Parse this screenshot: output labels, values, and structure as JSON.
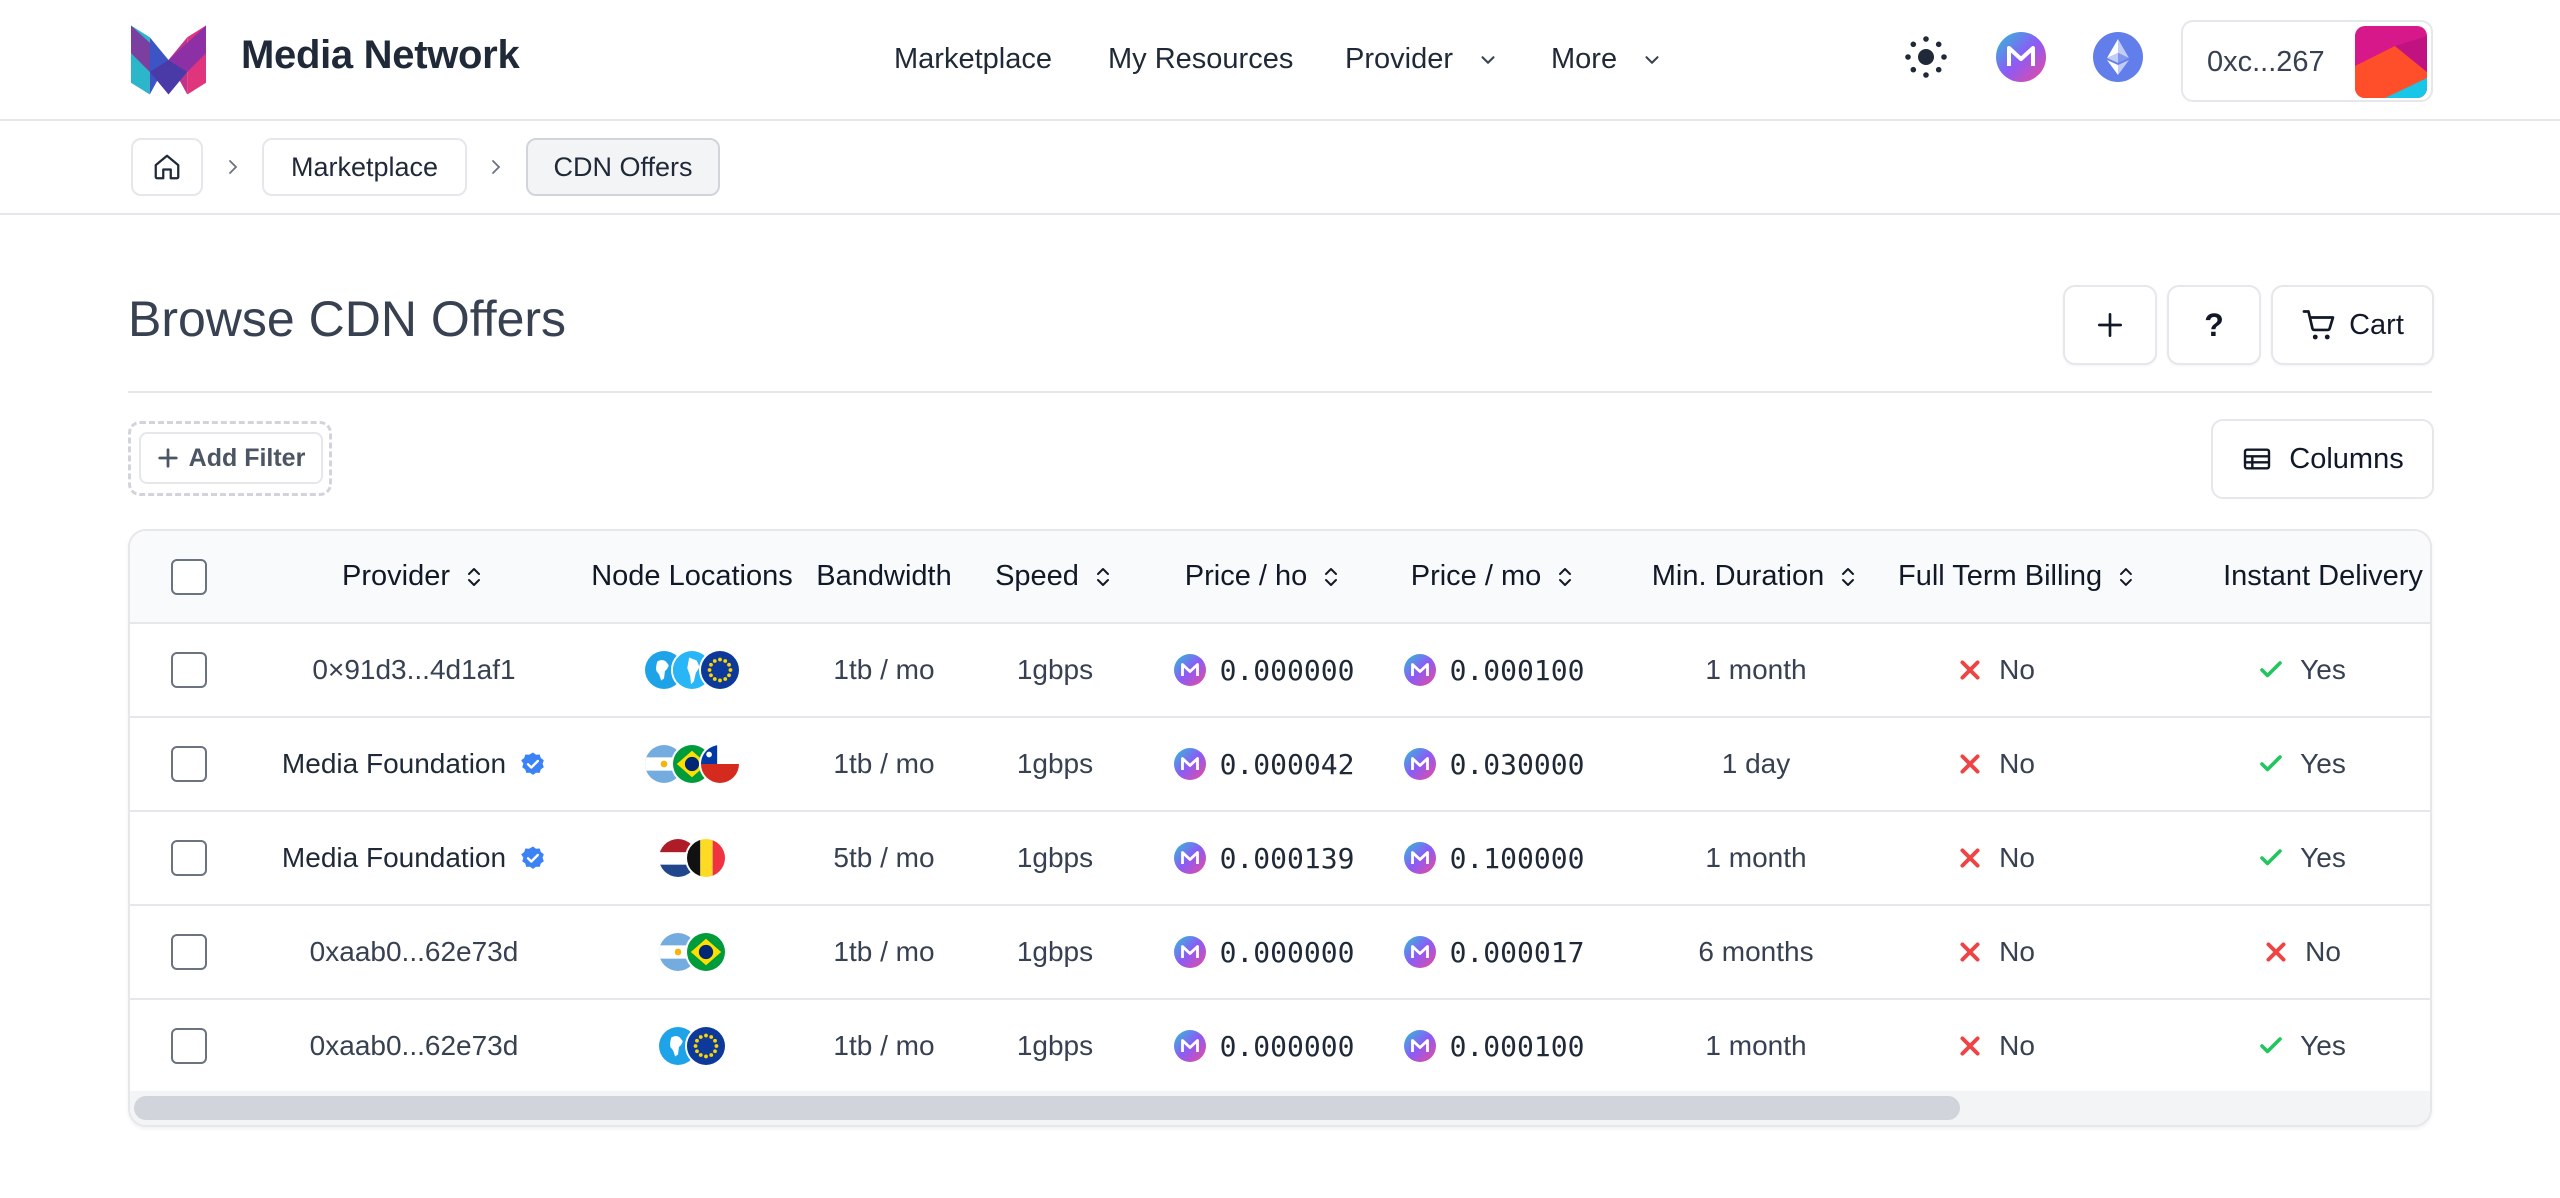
{
  "header": {
    "brand": "Media Network",
    "nav": [
      {
        "label": "Marketplace"
      },
      {
        "label": "My Resources"
      },
      {
        "label": "Provider"
      },
      {
        "label": "More"
      }
    ],
    "wallet_address": "0xc...267"
  },
  "breadcrumb": {
    "items": [
      "Marketplace",
      "CDN Offers"
    ]
  },
  "page": {
    "title": "Browse CDN Offers",
    "cart_label": "Cart",
    "help_label": "?",
    "add_filter_label": "Add Filter",
    "columns_label": "Columns"
  },
  "table": {
    "columns": [
      "Provider",
      "Node Locations",
      "Bandwidth",
      "Speed",
      "Price / ho",
      "Price / mo",
      "Min. Duration",
      "Full Term Billing",
      "Instant Delivery"
    ],
    "rows": [
      {
        "provider": "0×91d3...4d1af1",
        "verified": false,
        "flags": [
          "africa",
          "south-america",
          "eu"
        ],
        "bandwidth": "1tb / mo",
        "speed": "1gbps",
        "price_ho": "0.000000",
        "price_mo": "0.000100",
        "min_duration": "1 month",
        "full_term_billing": "No",
        "instant_delivery": "Yes"
      },
      {
        "provider": "Media Foundation",
        "verified": true,
        "flags": [
          "argentina",
          "brazil",
          "chile"
        ],
        "bandwidth": "1tb / mo",
        "speed": "1gbps",
        "price_ho": "0.000042",
        "price_mo": "0.030000",
        "min_duration": "1 day",
        "full_term_billing": "No",
        "instant_delivery": "Yes"
      },
      {
        "provider": "Media Foundation",
        "verified": true,
        "flags": [
          "netherlands",
          "belgium"
        ],
        "bandwidth": "5tb / mo",
        "speed": "1gbps",
        "price_ho": "0.000139",
        "price_mo": "0.100000",
        "min_duration": "1 month",
        "full_term_billing": "No",
        "instant_delivery": "Yes"
      },
      {
        "provider": "0xaab0...62e73d",
        "verified": false,
        "flags": [
          "argentina",
          "brazil"
        ],
        "bandwidth": "1tb / mo",
        "speed": "1gbps",
        "price_ho": "0.000000",
        "price_mo": "0.000017",
        "min_duration": "6 months",
        "full_term_billing": "No",
        "instant_delivery": "No"
      },
      {
        "provider": "0xaab0...62e73d",
        "verified": false,
        "flags": [
          "africa",
          "eu"
        ],
        "bandwidth": "1tb / mo",
        "speed": "1gbps",
        "price_ho": "0.000000",
        "price_mo": "0.000100",
        "min_duration": "1 month",
        "full_term_billing": "No",
        "instant_delivery": "Yes"
      }
    ]
  },
  "colors": {
    "yes": "#22c55e",
    "no": "#ef4444",
    "verified": "#3b82f6",
    "eth": "#627eea"
  },
  "icons": [
    "theme-toggle-icon",
    "media-token-icon",
    "ethereum-icon",
    "home-icon",
    "plus-icon",
    "cart-icon",
    "columns-icon",
    "sort-icon",
    "check-icon",
    "cross-icon",
    "verified-badge-icon"
  ]
}
